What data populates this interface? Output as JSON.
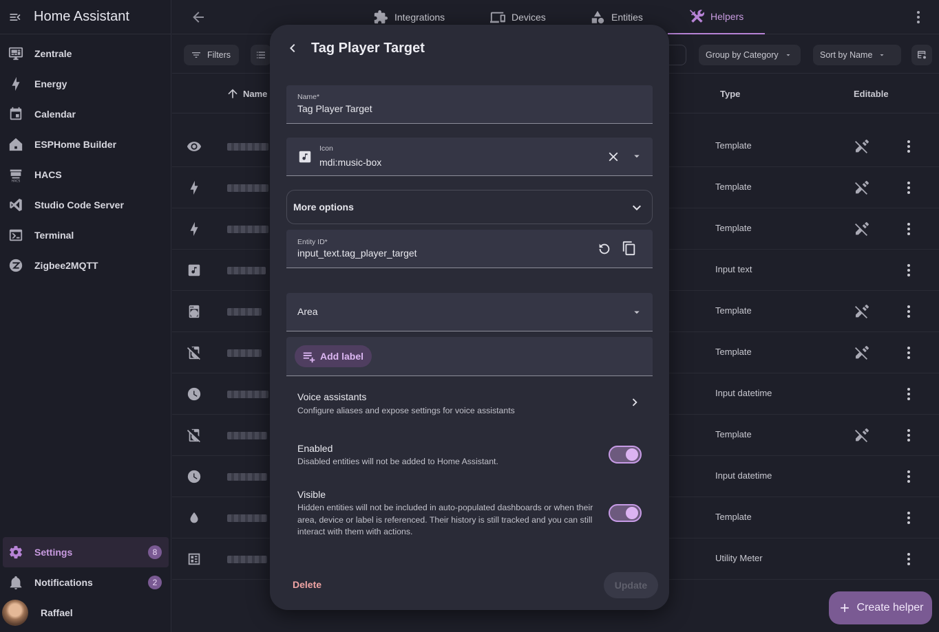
{
  "app": {
    "title": "Home Assistant"
  },
  "sidebar": {
    "items": [
      {
        "label": "Zentrale",
        "icon": "monitor-dashboard-icon"
      },
      {
        "label": "Energy",
        "icon": "lightning-bolt-icon"
      },
      {
        "label": "Calendar",
        "icon": "calendar-icon"
      },
      {
        "label": "ESPHome Builder",
        "icon": "esphome-icon"
      },
      {
        "label": "HACS",
        "icon": "hacs-icon"
      },
      {
        "label": "Studio Code Server",
        "icon": "vscode-icon"
      },
      {
        "label": "Terminal",
        "icon": "console-icon"
      },
      {
        "label": "Zigbee2MQTT",
        "icon": "zigbee-icon"
      }
    ],
    "settings": {
      "label": "Settings",
      "badge": "8"
    },
    "notifications": {
      "label": "Notifications",
      "badge": "2"
    },
    "user": {
      "name": "Raffael"
    }
  },
  "tabs": [
    {
      "label": "Integrations",
      "icon": "puzzle-icon"
    },
    {
      "label": "Devices",
      "icon": "devices-icon"
    },
    {
      "label": "Entities",
      "icon": "shapes-icon"
    },
    {
      "label": "Helpers",
      "icon": "tools-icon",
      "active": true
    }
  ],
  "toolbar": {
    "filters": "Filters",
    "group_by": "Group by Category",
    "sort_by": "Sort by Name"
  },
  "table": {
    "columns": {
      "name": "Name",
      "type": "Type",
      "editable": "Editable"
    },
    "rows": [
      {
        "icon": "eye-icon",
        "type": "Template",
        "editable_icon": true
      },
      {
        "icon": "lightning-bolt-icon",
        "type": "Template",
        "editable_icon": true
      },
      {
        "icon": "lightning-bolt-icon",
        "type": "Template",
        "editable_icon": true
      },
      {
        "icon": "music-box-icon",
        "type": "Input text",
        "editable_icon": false
      },
      {
        "icon": "washing-machine-icon",
        "type": "Template",
        "editable_icon": true
      },
      {
        "icon": "washing-machine-off-icon",
        "type": "Template",
        "editable_icon": true
      },
      {
        "icon": "clock-icon",
        "type": "Input datetime",
        "editable_icon": false
      },
      {
        "icon": "washing-machine-off-icon",
        "type": "Template",
        "editable_icon": true
      },
      {
        "icon": "clock-icon",
        "type": "Input datetime",
        "editable_icon": false
      },
      {
        "icon": "water-icon",
        "type": "Template",
        "editable_icon": false
      },
      {
        "icon": "meter-icon",
        "type": "Utility Meter",
        "editable_icon": false
      }
    ]
  },
  "dialog": {
    "title": "Tag Player Target",
    "name_label": "Name*",
    "name_value": "Tag Player Target",
    "icon_label": "Icon",
    "icon_value": "mdi:music-box",
    "more_options": "More options",
    "entity_id_label": "Entity ID*",
    "entity_id_value": "input_text.tag_player_target",
    "area_label": "Area",
    "add_label": "Add label",
    "voice": {
      "title": "Voice assistants",
      "subtitle": "Configure aliases and expose settings for voice assistants"
    },
    "enabled": {
      "title": "Enabled",
      "subtitle": "Disabled entities will not be added to Home Assistant.",
      "on": true
    },
    "visible": {
      "title": "Visible",
      "subtitle": "Hidden entities will not be included in auto-populated dashboards or when their area, device or label is referenced. Their history is still tracked and you can still interact with them with actions.",
      "on": true
    },
    "delete": "Delete",
    "update": "Update"
  },
  "fab": {
    "label": "Create helper"
  },
  "colors": {
    "accent": "#b783d6",
    "background": "#1e1f29",
    "dialog": "#2a2b37",
    "danger": "#f0a4a4"
  }
}
